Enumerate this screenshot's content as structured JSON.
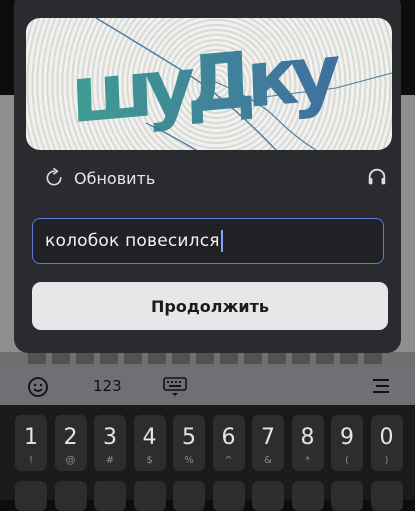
{
  "captcha": {
    "text": "шуДку",
    "colors": {
      "text_left": "#3f9c93",
      "text_right": "#3f6f9e",
      "crack": "#4f7ea3"
    }
  },
  "toolbar": {
    "refresh_label": "Обновить",
    "refresh_icon": "refresh-icon",
    "audio_icon": "headphones-icon"
  },
  "answer": {
    "value": "колобок повесился",
    "focus_color": "#5a7bd6"
  },
  "continue_label": "Продолжить",
  "keyboard": {
    "toolbar": {
      "emoji_icon": "emoji-icon",
      "numbers_label": "123",
      "keyboard_icon": "keyboard-hide-icon",
      "menu_icon": "menu-icon"
    },
    "keys": [
      {
        "main": "1",
        "sub": "!"
      },
      {
        "main": "2",
        "sub": "@"
      },
      {
        "main": "3",
        "sub": "#"
      },
      {
        "main": "4",
        "sub": "$"
      },
      {
        "main": "5",
        "sub": "%"
      },
      {
        "main": "6",
        "sub": "^"
      },
      {
        "main": "7",
        "sub": "&"
      },
      {
        "main": "8",
        "sub": "*"
      },
      {
        "main": "9",
        "sub": "("
      },
      {
        "main": "0",
        "sub": ")"
      }
    ]
  }
}
